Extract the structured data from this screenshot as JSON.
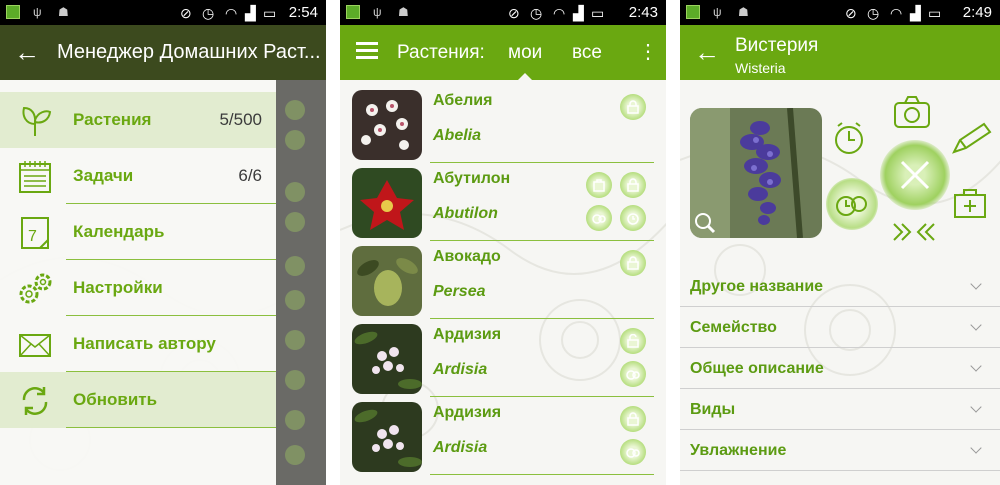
{
  "colors": {
    "accent": "#6aa811",
    "dark_bar": "#3c4a1e",
    "text_green": "#5c9b12"
  },
  "screens": [
    {
      "status_time": "2:54",
      "title": "Менеджер Домашних Раст...",
      "menu": [
        {
          "label": "Растения",
          "count": "5/500",
          "icon": "leaf-icon",
          "selected": true
        },
        {
          "label": "Задачи",
          "count": "6/6",
          "icon": "tasks-icon",
          "selected": false
        },
        {
          "label": "Календарь",
          "count": "",
          "icon": "calendar-icon",
          "selected": false
        },
        {
          "label": "Настройки",
          "count": "",
          "icon": "gears-icon",
          "selected": false
        },
        {
          "label": "Написать автору",
          "count": "",
          "icon": "mail-icon",
          "selected": false
        },
        {
          "label": "Обновить",
          "count": "",
          "icon": "refresh-icon",
          "selected": true
        }
      ],
      "calendar_digit": "7"
    },
    {
      "status_time": "2:43",
      "title": "Растения:",
      "tab_my": "мои",
      "tab_all": "все",
      "plants": [
        {
          "name": "Абелия",
          "latin": "Abelia",
          "icons": [
            "lock-icon"
          ]
        },
        {
          "name": "Абутилон",
          "latin": "Abutilon",
          "icons": [
            "bag-icon",
            "lock-icon",
            "alarm-multi-icon",
            "alarm-icon"
          ]
        },
        {
          "name": "Авокадо",
          "latin": "Persea",
          "icons": [
            "lock-icon"
          ]
        },
        {
          "name": "Ардизия",
          "latin": "Ardisia",
          "icons": [
            "unlock-icon",
            "alarm-multi-icon"
          ]
        },
        {
          "name": "Ардизия",
          "latin": "Ardisia",
          "icons": [
            "lock-icon",
            "alarm-multi-icon"
          ]
        }
      ]
    },
    {
      "status_time": "2:49",
      "title": "Вистерия",
      "subtitle": "Wisteria",
      "sections": [
        "Другое название",
        "Семейство",
        "Общее описание",
        "Виды",
        "Увлажнение"
      ]
    }
  ]
}
